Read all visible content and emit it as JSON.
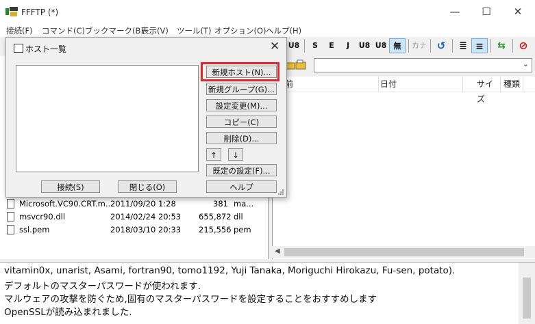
{
  "window": {
    "title": "FFFTP (*)",
    "minimize": "—",
    "maximize": "☐",
    "close": "✕"
  },
  "menu": [
    "接続(F)",
    "コマンド(C)",
    "ブックマーク(B)",
    "表示(V)",
    "ツール(T)",
    "オプション(O)",
    "ヘルプ(H)"
  ],
  "toolbar": {
    "buttons": [
      "U8",
      "S",
      "E",
      "J",
      "U8",
      "U8",
      "無",
      "カナ",
      "↺",
      "≣",
      "≡",
      "⇆",
      "⊘"
    ]
  },
  "local_files": [
    {
      "name": "Microsoft.VC90.CRT.m...",
      "date": "2011/09/20 1:28",
      "size": "381",
      "type": "ma..."
    },
    {
      "name": "msvcr90.dll",
      "date": "2014/02/24 20:53",
      "size": "655,872",
      "type": "dll"
    },
    {
      "name": "ssl.pem",
      "date": "2018/03/10 20:33",
      "size": "215,556",
      "type": "pem"
    }
  ],
  "remote_columns": {
    "name": "前",
    "date": "日付",
    "size": "サイズ",
    "kind": "種類"
  },
  "remote_path": "",
  "log": [
    "vitamin0x, unarist, Asami, fortran90, tomo1192, Yuji Tanaka, Moriguchi Hirokazu, Fu-sen, potato).",
    "デフォルトのマスターパスワードが使われます.",
    "マルウェアの攻撃を防ぐため,固有のマスターパスワードを設定することをおすすめします",
    "OpenSSLが読み込まれました."
  ],
  "dialog": {
    "title": "ホスト一覧",
    "close": "✕",
    "new_host": "新規ホスト(N)...",
    "new_group": "新規グループ(G)...",
    "change_settings": "設定変更(M)...",
    "copy": "コピー(C)",
    "delete": "削除(D)...",
    "up": "↑",
    "down": "↓",
    "defaults": "既定の設定(F)...",
    "help": "ヘルプ",
    "connect": "接続(S)",
    "close_btn": "閉じる(O)"
  },
  "colors": {
    "highlight": "#e3242b"
  }
}
